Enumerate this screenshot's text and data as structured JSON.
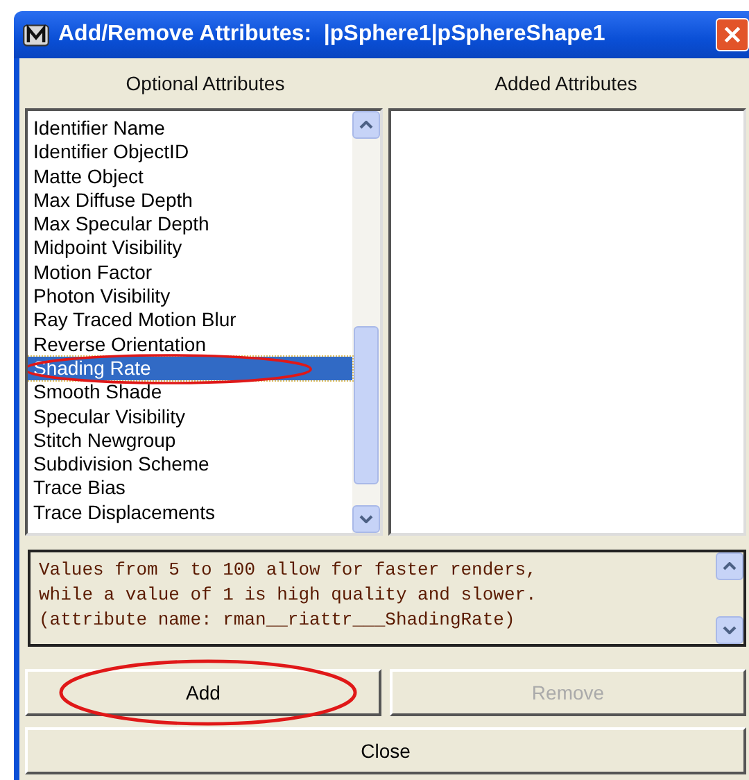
{
  "window": {
    "title": "Add/Remove Attributes:  |pSphere1|pSphereShape1"
  },
  "columns": [
    {
      "label": "Optional Attributes"
    },
    {
      "label": "Added Attributes"
    }
  ],
  "optional_attributes": [
    {
      "label": "Identifier Name",
      "selected": false,
      "circled": false
    },
    {
      "label": "Identifier ObjectID",
      "selected": false,
      "circled": false
    },
    {
      "label": "Matte Object",
      "selected": false,
      "circled": false
    },
    {
      "label": "Max Diffuse Depth",
      "selected": false,
      "circled": false
    },
    {
      "label": "Max Specular Depth",
      "selected": false,
      "circled": false
    },
    {
      "label": "Midpoint Visibility",
      "selected": false,
      "circled": false
    },
    {
      "label": "Motion Factor",
      "selected": false,
      "circled": false
    },
    {
      "label": "Photon Visibility",
      "selected": false,
      "circled": false
    },
    {
      "label": "Ray Traced Motion Blur",
      "selected": false,
      "circled": false
    },
    {
      "label": "Reverse Orientation",
      "selected": false,
      "circled": false
    },
    {
      "label": "Shading Rate",
      "selected": true,
      "circled": true
    },
    {
      "label": "Smooth Shade",
      "selected": false,
      "circled": false
    },
    {
      "label": "Specular Visibility",
      "selected": false,
      "circled": false
    },
    {
      "label": "Stitch Newgroup",
      "selected": false,
      "circled": false
    },
    {
      "label": "Subdivision Scheme",
      "selected": false,
      "circled": false
    },
    {
      "label": "Trace Bias",
      "selected": false,
      "circled": false
    },
    {
      "label": "Trace Displacements",
      "selected": false,
      "circled": false
    }
  ],
  "description": [
    "Values from 5 to 100 allow for faster renders,",
    "while a value of 1 is high quality and slower.",
    "(attribute name: rman__riattr___ShadingRate)"
  ],
  "buttons": [
    {
      "label": "Add",
      "disabled": false,
      "circled": true
    },
    {
      "label": "Remove",
      "disabled": true,
      "circled": false
    }
  ],
  "close_button": {
    "label": "Close"
  }
}
